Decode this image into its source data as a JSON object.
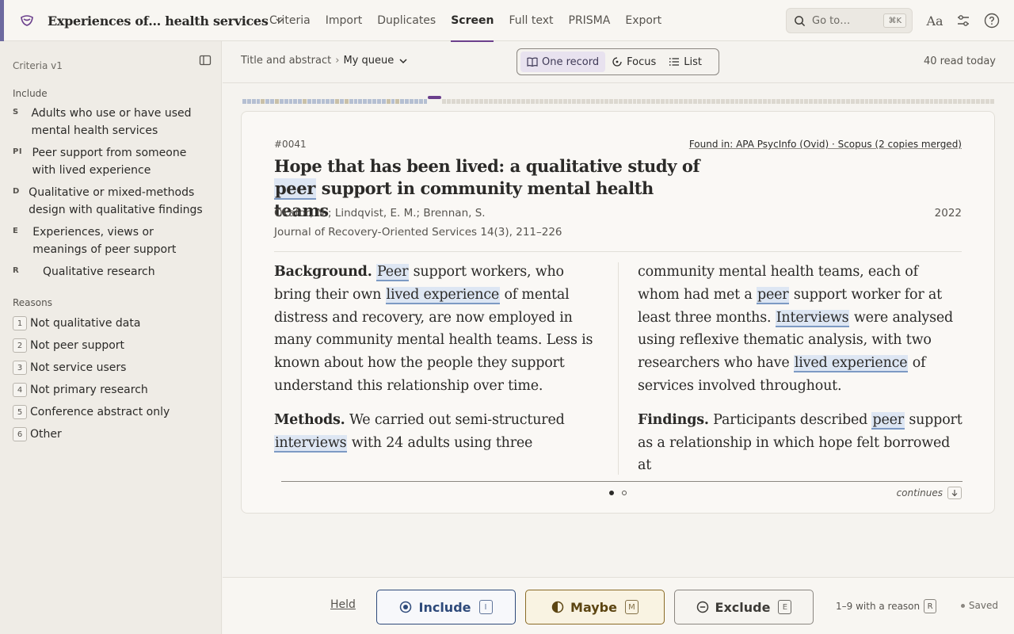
{
  "header": {
    "project_title": "Experiences of… health services",
    "nav": [
      "Criteria",
      "Import",
      "Duplicates",
      "Screen",
      "Full text",
      "PRISMA",
      "Export"
    ],
    "active_nav": "Screen",
    "goto_placeholder": "Go to…",
    "goto_shortcut": "⌘K",
    "font_button": "Aa"
  },
  "sidebar": {
    "title": "Criteria v1",
    "include_heading": "Include",
    "criteria": [
      {
        "letter": "S",
        "text": "Adults who use or have used mental health services"
      },
      {
        "letter": "PI",
        "text": "Peer support from someone with lived experience"
      },
      {
        "letter": "D",
        "text": "Qualitative or mixed-methods design with qualitative findings"
      },
      {
        "letter": "E",
        "text": "Experiences, views or meanings of peer support"
      },
      {
        "letter": "R",
        "text": "Qualitative research"
      }
    ],
    "reasons_heading": "Reasons",
    "reasons": [
      {
        "key": "1",
        "label": "Not qualitative data"
      },
      {
        "key": "2",
        "label": "Not peer support"
      },
      {
        "key": "3",
        "label": "Not service users"
      },
      {
        "key": "4",
        "label": "Not primary research"
      },
      {
        "key": "5",
        "label": "Conference abstract only"
      },
      {
        "key": "6",
        "label": "Other"
      }
    ]
  },
  "subbar": {
    "breadcrumb_stage": "Title and abstract",
    "breadcrumb_sep": "›",
    "queue": "My queue",
    "views": [
      "One record",
      "Focus",
      "List"
    ],
    "active_view": "One record",
    "read_today": "40 read today"
  },
  "record": {
    "id": "#0041",
    "found_in": "Found in: APA PsycInfo (Ovid) · Scopus (2 copies merged)",
    "title_prefix": "Hope that has been lived: a qualitative study of",
    "title_highlight": "peer",
    "title_suffix": "support in community mental health teams",
    "authors": "Okafor, N.; Lindqvist, E. M.; Brennan, S.",
    "year": "2022",
    "journal": "Journal of Recovery-Oriented Services 14(3), 211–226",
    "continues_label": "continues",
    "page_count": 2,
    "current_page": 1
  },
  "abstract": {
    "background_label": "Background.",
    "methods_label": "Methods.",
    "findings_label": "Findings.",
    "highlight_terms": [
      "peer",
      "lived experience",
      "interviews"
    ]
  },
  "actions": {
    "held": "Held",
    "include": "Include",
    "include_key": "I",
    "maybe": "Maybe",
    "maybe_key": "M",
    "exclude": "Exclude",
    "exclude_key": "E",
    "reason_hint": "1–9 with a reason",
    "reason_key": "R",
    "status": "Saved"
  },
  "progress": {
    "done": 40,
    "current": 41
  },
  "colors": {
    "accent": "#6b3f8c",
    "include": "#2e4a7a",
    "maybe": "#8a6b26",
    "highlight": "#dde6f3"
  }
}
